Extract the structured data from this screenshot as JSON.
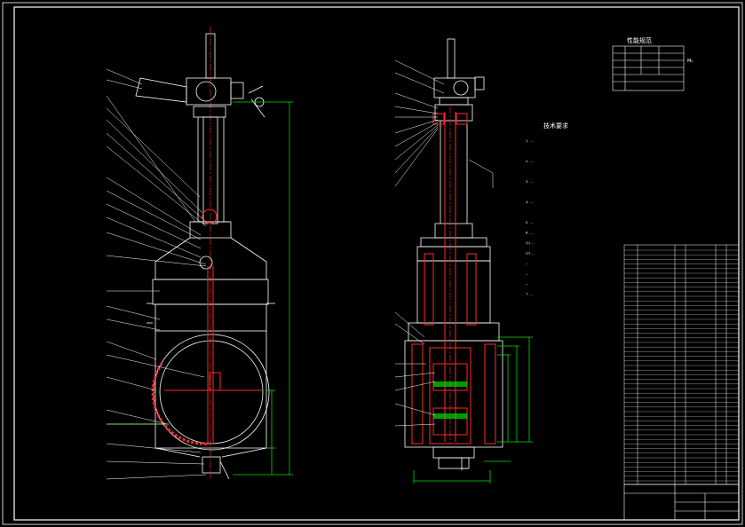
{
  "drawing": {
    "colors": {
      "background": "#000000",
      "outline": "#ffffff",
      "section": "#ff2a2a",
      "dimension": "#00e000",
      "hatch": "#ff6666",
      "accent": "#b0b0b0",
      "yellow": "#ffff33"
    },
    "table": {
      "title": "性能规范",
      "rows": [
        [
          "",
          "",
          "",
          ""
        ],
        [
          "",
          "",
          "",
          ""
        ],
        [
          "",
          "",
          "",
          ""
        ],
        [
          "",
          "",
          "",
          ""
        ],
        [
          "",
          "",
          "",
          ""
        ],
        [
          "",
          "",
          "",
          ""
        ]
      ],
      "unit": "M₀"
    },
    "notes": {
      "title": "技术要求",
      "lines": [
        "1. ...",
        "",
        "2. ...",
        "",
        "3. ...",
        "",
        "4. ...",
        "",
        "5. ...",
        "6. ...",
        "(1) ...",
        "(2) ...",
        "...",
        "...",
        "...",
        "7. ..."
      ]
    },
    "title_block": {
      "name": ""
    }
  }
}
